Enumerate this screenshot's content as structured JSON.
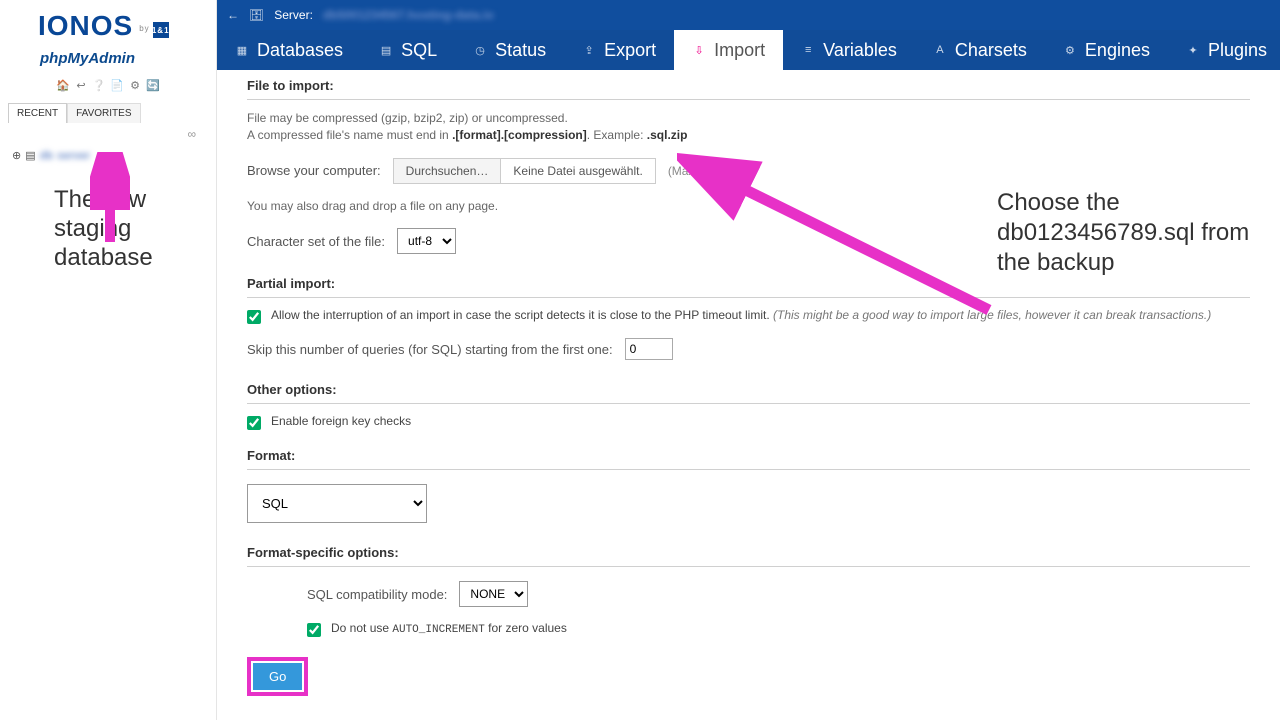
{
  "sidebar": {
    "logo": "IONOS",
    "logo_by": "by",
    "logo_badge": "1&1",
    "subtitle": "phpMyAdmin",
    "tabs": {
      "recent": "RECENT",
      "favorites": "FAVORITES"
    },
    "link_sym": "∞",
    "tree_blur1": "db",
    "tree_blur2": "server",
    "annot": "The new staging database"
  },
  "serverbar": {
    "label": "Server:",
    "value": "db5001234567.hosting-data.io"
  },
  "navtabs": [
    {
      "label": "Databases"
    },
    {
      "label": "SQL"
    },
    {
      "label": "Status"
    },
    {
      "label": "Export"
    },
    {
      "label": "Import"
    },
    {
      "label": "Variables"
    },
    {
      "label": "Charsets"
    },
    {
      "label": "Engines"
    },
    {
      "label": "Plugins"
    }
  ],
  "file_section": {
    "title": "File to import:",
    "help1": "File may be compressed (gzip, bzip2, zip) or uncompressed.",
    "help2a": "A compressed file's name must end in ",
    "help2b": ".[format].[compression]",
    "help2c": ". Example: ",
    "help2d": ".sql.zip",
    "browse_label": "Browse your computer:",
    "browse_btn": "Durchsuchen…",
    "no_file": "Keine Datei ausgewählt.",
    "max": "(Max: 1,000MiB)",
    "drag": "You may also drag and drop a file on any page.",
    "charset_label": "Character set of the file:",
    "charset_value": "utf-8"
  },
  "partial": {
    "title": "Partial import:",
    "interrupt_label": "Allow the interruption of an import in case the script detects it is close to the PHP timeout limit. ",
    "interrupt_note": "(This might be a good way to import large files, however it can break transactions.)",
    "skip_label": "Skip this number of queries (for SQL) starting from the first one:",
    "skip_value": "0"
  },
  "other": {
    "title": "Other options:",
    "fk_label": "Enable foreign key checks"
  },
  "format": {
    "title": "Format:",
    "value": "SQL"
  },
  "fso": {
    "title": "Format-specific options:",
    "compat_label": "SQL compatibility mode:",
    "compat_value": "NONE",
    "autoinc_a": "Do not use ",
    "autoinc_code": "AUTO_INCREMENT",
    "autoinc_b": " for zero values"
  },
  "go": "Go",
  "annot2": "Choose the db0123456789.sql from the backup",
  "colors": {
    "accent": "#e731c7",
    "nav": "#114c98"
  }
}
